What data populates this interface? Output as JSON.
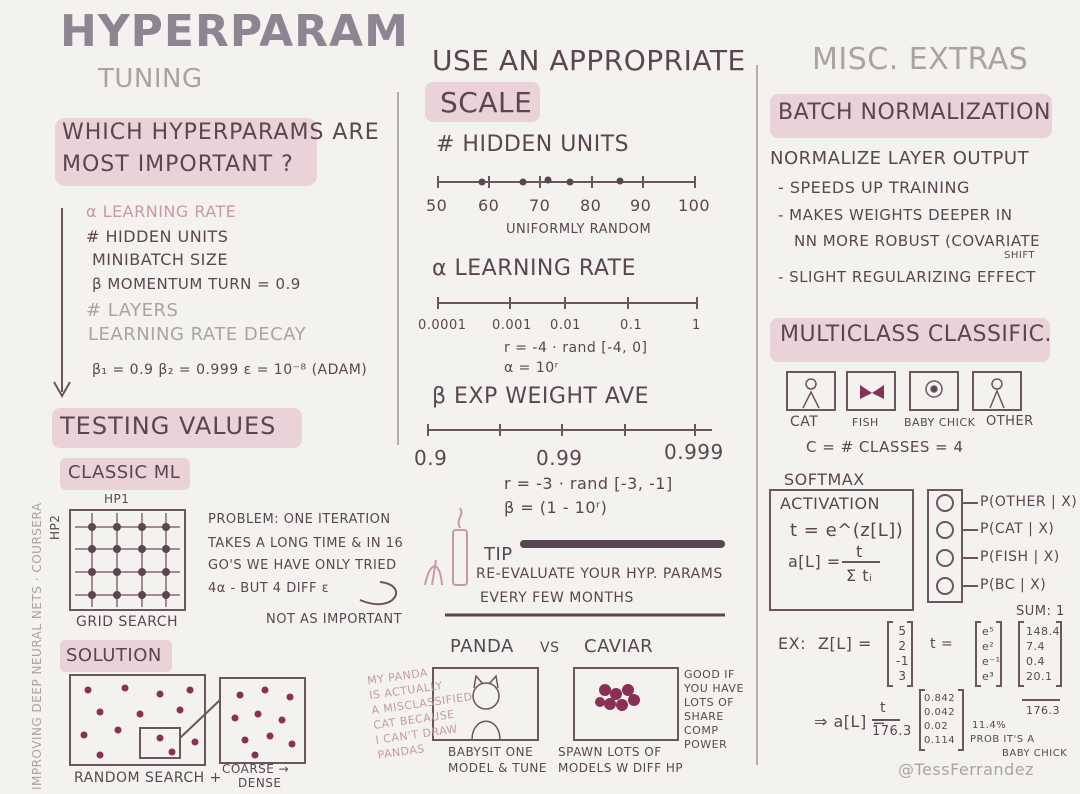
{
  "header": {
    "title": "HYPERPARAM",
    "subtitle": "TUNING"
  },
  "left": {
    "important": {
      "heading_line1": "WHICH HYPERPARAMS ARE",
      "heading_line2": "MOST IMPORTANT ?",
      "items": [
        "α LEARNING RATE",
        "# HIDDEN UNITS",
        "MINIBATCH SIZE",
        "β MOMENTUM TURN = 0.9",
        "# LAYERS",
        "LEARNING RATE DECAY",
        "β₁ = 0.9  β₂ = 0.999  ε = 10⁻⁸ (ADAM)"
      ]
    },
    "testing": {
      "heading": "TESTING VALUES",
      "classic": "CLASSIC ML",
      "hp1": "HP1",
      "hp2": "HP2",
      "grid_label": "GRID SEARCH",
      "problem_lines": [
        "PROBLEM: ONE ITERATION",
        "TAKES A LONG TIME & IN 16",
        "GO'S WE HAVE ONLY TRIED",
        "4α - BUT 4 DIFF ε"
      ],
      "not_important": "NOT AS IMPORTANT",
      "solution": "SOLUTION",
      "random_label": "RANDOM SEARCH +",
      "coarse_label_1": "COARSE →",
      "coarse_label_2": "DENSE"
    },
    "side_credit": "IMPROVING DEEP NEURAL NETS · COURSERA"
  },
  "middle": {
    "heading_line1": "USE AN APPROPRIATE",
    "heading_line2": "SCALE",
    "hidden_units": {
      "label": "# HIDDEN UNITS",
      "ticks": [
        "50",
        "60",
        "70",
        "80",
        "90",
        "100"
      ],
      "caption": "UNIFORMLY RANDOM"
    },
    "learning_rate": {
      "label": "α LEARNING RATE",
      "ticks": [
        "0.0001",
        "0.001",
        "0.01",
        "0.1",
        "1"
      ],
      "formula1": "r = -4 · rand [-4, 0]",
      "formula2": "α = 10ʳ"
    },
    "exp_weight": {
      "label": "β EXP WEIGHT AVE",
      "ticks": [
        "0.9",
        "0.99",
        "0.999"
      ],
      "formula1": "r = -3 · rand [-3, -1]",
      "formula2": "β = (1 - 10ʳ)"
    },
    "tip": {
      "label": "TIP",
      "line1": "RE-EVALUATE YOUR HYP. PARAMS",
      "line2": "EVERY FEW MONTHS"
    },
    "panda": "PANDA",
    "vs": "VS",
    "caviar": "CAVIAR",
    "panda_note": [
      "MY PANDA",
      "IS ACTUALLY",
      "A MISCLASSIFIED",
      "CAT BECAUSE",
      "I CAN'T DRAW",
      "PANDAS"
    ],
    "panda_caption": [
      "BABYSIT ONE",
      "MODEL & TUNE"
    ],
    "caviar_caption": [
      "SPAWN LOTS OF",
      "MODELS W DIFF HP"
    ],
    "caviar_note": [
      "GOOD IF",
      "YOU HAVE",
      "LOTS OF",
      "SHARE",
      "COMP",
      "POWER"
    ]
  },
  "right": {
    "heading": "MISC. EXTRAS",
    "batchnorm": {
      "heading": "BATCH NORMALIZATION",
      "line0": "NORMALIZE LAYER OUTPUT",
      "line1": "- SPEEDS UP TRAINING",
      "line2": "- MAKES WEIGHTS DEEPER IN",
      "line3": "NN MORE ROBUST (COVARIATE",
      "line3b": "SHIFT",
      "line4": "- SLIGHT REGULARIZING EFFECT"
    },
    "multiclass": {
      "heading": "MULTICLASS CLASSIFIC.",
      "classes": [
        "CAT",
        "FISH",
        "BABY CHICK",
        "OTHER"
      ],
      "count": "C = # CLASSES = 4",
      "softmax_label": "SOFTMAX",
      "activation_label": "ACTIVATION",
      "formula_t": "t = e^(z[L])",
      "formula_a_lhs": "a[L] =",
      "formula_a_num": "t",
      "formula_a_den": "Σ tᵢ",
      "outputs": [
        "P(OTHER | X)",
        "P(CAT | X)",
        "P(FISH | X)",
        "P(BC | X)"
      ],
      "sum_label": "SUM: 1",
      "ex_label": "EX:",
      "z_label": "Z[L] =",
      "z_values": [
        "5",
        "2",
        "-1",
        "3"
      ],
      "t_label": "t =",
      "t_values": [
        "e⁵",
        "e²",
        "e⁻¹",
        "e³"
      ],
      "t_results": [
        "148.4",
        "7.4",
        "0.4",
        "20.1"
      ],
      "t_sum": "176.3",
      "a_lhs": "⇒ a[L] =",
      "a_num": "t",
      "a_den": "176.3",
      "a_values": [
        "0.842",
        "0.042",
        "0.02",
        "0.114"
      ],
      "prob_note_1": "11.4%",
      "prob_note_2": "PROB IT'S A",
      "prob_note_3": "BABY CHICK"
    },
    "credit": "@TessFerrandez"
  }
}
